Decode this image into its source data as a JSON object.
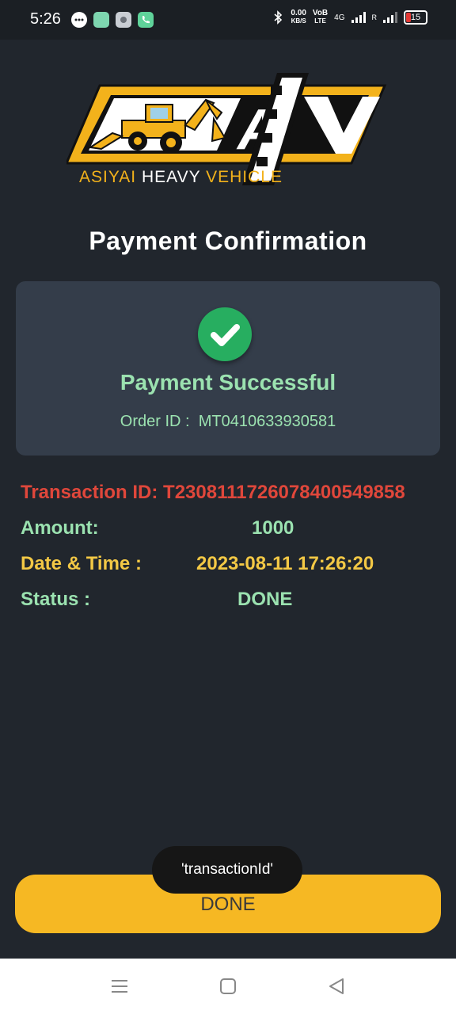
{
  "status_bar": {
    "time": "5:26",
    "net_speed_value": "0.00",
    "net_speed_unit": "KB/S",
    "volte_top": "VoB",
    "volte_bottom": "LTE",
    "network": "4G",
    "roaming": "R",
    "battery": "15",
    "icons": [
      "messenger-icon",
      "gallery-app-icon",
      "settings-app-icon",
      "phone-app-icon",
      "bluetooth-icon",
      "signal-icon",
      "battery-icon"
    ]
  },
  "logo": {
    "monogram": "AHV",
    "tagline_part1": "ASIYAI",
    "tagline_part2": "HEAVY",
    "tagline_part3": "VEHICLE",
    "colors": {
      "yellow": "#f3b21b",
      "black": "#111111",
      "white": "#ffffff"
    }
  },
  "page": {
    "title": "Payment Confirmation"
  },
  "card": {
    "status_icon": "check-circle-icon",
    "status": "Payment Successful",
    "order_label": "Order ID :",
    "order_id": "MT0410633930581"
  },
  "details": {
    "transaction_label": "Transaction ID:",
    "transaction_id": "T2308111726078400549858",
    "amount_label": "Amount:",
    "amount_value": "1000",
    "datetime_label": "Date & Time :",
    "datetime_value": "2023-08-11 17:26:20",
    "status_label": "Status :",
    "status_value": "DONE"
  },
  "button": {
    "label": "DONE"
  },
  "toast": {
    "text": "'transactionId'"
  },
  "navbar": {
    "icons": [
      "menu-icon",
      "home-square-icon",
      "back-triangle-icon"
    ]
  },
  "colors": {
    "background": "#21262d",
    "card": "#343d4a",
    "success_green": "#9be2b0",
    "error_red": "#e0473b",
    "accent_yellow": "#f6b823"
  }
}
